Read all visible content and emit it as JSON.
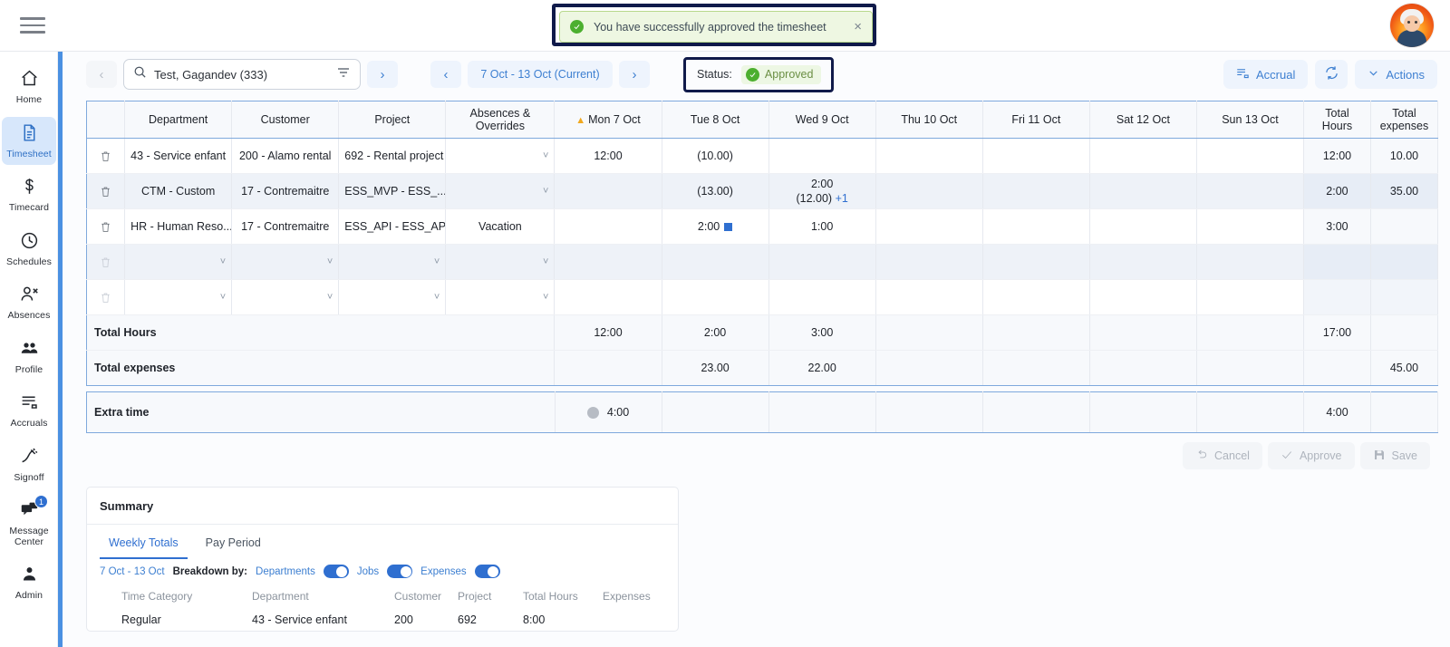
{
  "topbar": {
    "menu_icon": "hamburger-icon",
    "avatar_alt": "user-avatar"
  },
  "toast": {
    "message": "You have successfully approved the timesheet",
    "close_label": "×",
    "icon": "check-circle-icon",
    "bg_color": "#eef7e2",
    "border_color": "#b8d98c",
    "annotation_color": "#101a4a"
  },
  "sidebar": {
    "items": [
      {
        "label": "Home",
        "icon": "home-icon",
        "active": false
      },
      {
        "label": "Timesheet",
        "icon": "document-icon",
        "active": true
      },
      {
        "label": "Timecard",
        "icon": "dollar-icon",
        "active": false
      },
      {
        "label": "Schedules",
        "icon": "clock-icon",
        "active": false
      },
      {
        "label": "Absences",
        "icon": "person-remove-icon",
        "active": false
      },
      {
        "label": "Profile",
        "icon": "people-icon",
        "active": false
      },
      {
        "label": "Accruals",
        "icon": "list-icon",
        "active": false
      },
      {
        "label": "Signoff",
        "icon": "signature-icon",
        "active": false
      },
      {
        "label": "Message Center",
        "icon": "chat-icon",
        "active": false,
        "badge": "1"
      },
      {
        "label": "Admin",
        "icon": "person-icon",
        "active": false
      }
    ],
    "accent_color": "#2d6fc4"
  },
  "toolbar": {
    "prev_employee": "‹",
    "next_employee": "›",
    "search_value": "Test, Gagandev (333)",
    "search_icon": "search-icon",
    "filter_icon": "filter-icon",
    "prev_period": "‹",
    "next_period": "›",
    "period": "7 Oct - 13 Oct (Current)",
    "status_label": "Status:",
    "status_value": "Approved",
    "accrual_label": "Accrual",
    "refresh_icon": "refresh-icon",
    "actions_label": "Actions",
    "actions_caret": "⌄"
  },
  "grid": {
    "columns": [
      "",
      "Department",
      "Customer",
      "Project",
      "Absences & Overrides",
      "Mon 7 Oct",
      "Tue 8 Oct",
      "Wed 9 Oct",
      "Thu 10 Oct",
      "Fri 11 Oct",
      "Sat 12 Oct",
      "Sun 13 Oct",
      "Total Hours",
      "Total expenses"
    ],
    "mon_has_warning": true,
    "rows": [
      {
        "department": "43 - Service enfant",
        "customer": "200 - Alamo rental",
        "project": "692 - Rental project",
        "absences": "",
        "mon": "12:00",
        "tue": "(10.00)",
        "wed": "",
        "wed2": "",
        "wed_plus": "",
        "thu": "",
        "fri": "",
        "sat": "",
        "sun": "",
        "total_hours": "12:00",
        "total_expenses": "10.00",
        "tue_flag": false
      },
      {
        "department": "CTM - Custom",
        "customer": "17 - Contremaitre",
        "project": "ESS_MVP - ESS_...",
        "absences": "",
        "mon": "",
        "tue": "(13.00)",
        "wed": "2:00",
        "wed2": "(12.00)",
        "wed_plus": "+1",
        "thu": "",
        "fri": "",
        "sat": "",
        "sun": "",
        "total_hours": "2:00",
        "total_expenses": "35.00",
        "tue_flag": false
      },
      {
        "department": "HR - Human Reso...",
        "customer": "17 - Contremaitre",
        "project": "ESS_API - ESS_AP...",
        "absences": "Vacation",
        "mon": "",
        "tue": "2:00",
        "wed": "1:00",
        "wed2": "",
        "wed_plus": "",
        "thu": "",
        "fri": "",
        "sat": "",
        "sun": "",
        "total_hours": "3:00",
        "total_expenses": "",
        "tue_flag": true
      }
    ],
    "empty_rows": 2,
    "totals": {
      "hours_label": "Total Hours",
      "hours": {
        "mon": "12:00",
        "tue": "2:00",
        "wed": "3:00",
        "thu": "",
        "fri": "",
        "sat": "",
        "sun": "",
        "total": "17:00",
        "expenses": ""
      },
      "expenses_label": "Total expenses",
      "expenses": {
        "mon": "",
        "tue": "23.00",
        "wed": "22.00",
        "thu": "",
        "fri": "",
        "sat": "",
        "sun": "",
        "total": "",
        "expenses": "45.00"
      }
    },
    "extra_time": {
      "label": "Extra time",
      "mon": "4:00",
      "tue": "",
      "wed": "",
      "thu": "",
      "fri": "",
      "sat": "",
      "sun": "",
      "total": "4:00",
      "expenses": ""
    }
  },
  "action_buttons": {
    "cancel": "Cancel",
    "approve": "Approve",
    "save": "Save"
  },
  "summary": {
    "title": "Summary",
    "tabs": [
      {
        "label": "Weekly Totals",
        "active": true
      },
      {
        "label": "Pay Period",
        "active": false
      }
    ],
    "range": "7 Oct - 13 Oct",
    "breakdown_label": "Breakdown by:",
    "toggles": [
      {
        "label": "Departments",
        "on": true
      },
      {
        "label": "Jobs",
        "on": true
      },
      {
        "label": "Expenses",
        "on": true
      }
    ],
    "columns": [
      "Time Category",
      "Department",
      "Customer",
      "Project",
      "Total Hours",
      "Expenses"
    ],
    "rows": [
      {
        "time_category": "Regular",
        "department": "43 - Service enfant",
        "customer": "200",
        "project": "692",
        "total_hours": "8:00",
        "expenses": ""
      }
    ]
  }
}
